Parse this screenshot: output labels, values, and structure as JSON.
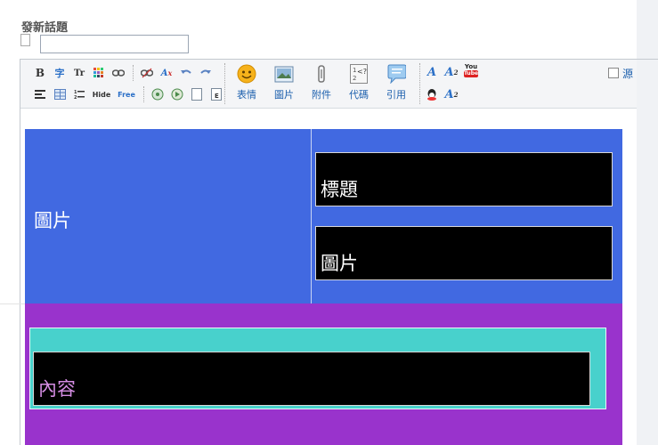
{
  "form": {
    "title_label": "發新話題",
    "title_value": ""
  },
  "toolbar": {
    "row1_buttons": [
      "B",
      "fontface",
      "Tr",
      "color",
      "link",
      "unlink",
      "removeformat",
      "undo",
      "redo"
    ],
    "row2_buttons": [
      "align",
      "table",
      "list",
      "Hide",
      "Free",
      "media",
      "flash",
      "page",
      "index"
    ],
    "hide_label": "Hide",
    "free_label": "Free",
    "big_buttons": [
      {
        "label": "表情",
        "icon": "smiley-icon"
      },
      {
        "label": "圖片",
        "icon": "image-icon"
      },
      {
        "label": "附件",
        "icon": "paperclip-icon"
      },
      {
        "label": "代碼",
        "icon": "code-icon"
      },
      {
        "label": "引用",
        "icon": "quote-icon"
      }
    ],
    "youtube_top": "You",
    "youtube_bottom": "Tube",
    "source_label": "源"
  },
  "content": {
    "left_image_label": "圖片",
    "title_box_label": "標題",
    "image_box_label": "圖片",
    "body_box_label": "內容"
  },
  "colors": {
    "blue": "#4169e1",
    "purple": "#9933cc",
    "cyan": "#48d1cc",
    "black": "#000000",
    "link": "#1b5fad"
  }
}
